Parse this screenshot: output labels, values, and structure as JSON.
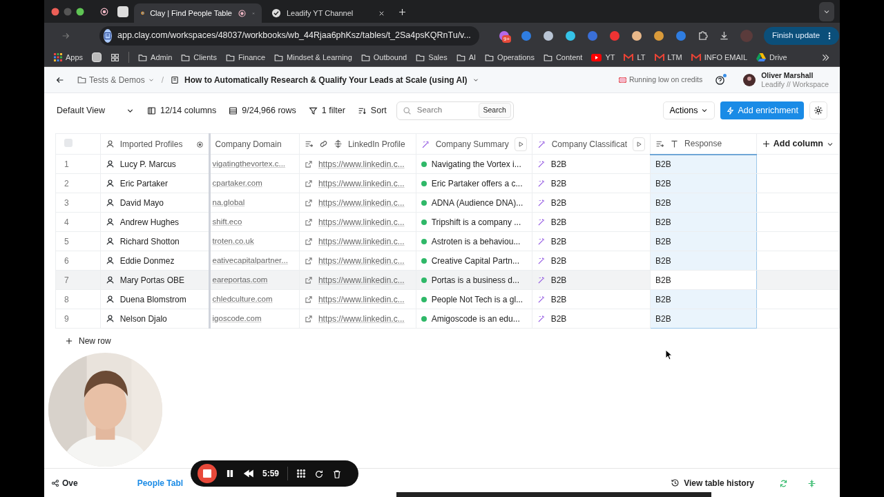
{
  "browser": {
    "tabs": [
      {
        "title": "Clay | Find People Table",
        "selected": true
      },
      {
        "title": "Leadify YT Channel",
        "selected": false
      }
    ],
    "url": "app.clay.com/workspaces/48037/workbooks/wb_44Rjaa6phKsz/tables/t_2Sa4psKQRnTu/v...",
    "extension_badge": "9+",
    "update_button": "Finish update",
    "bookmarks": [
      {
        "label": "Apps",
        "kind": "apps"
      },
      {
        "label": "Admin",
        "kind": "folder"
      },
      {
        "label": "Clients",
        "kind": "folder"
      },
      {
        "label": "Finance",
        "kind": "folder"
      },
      {
        "label": "Mindset & Learning",
        "kind": "folder"
      },
      {
        "label": "Outbound",
        "kind": "folder"
      },
      {
        "label": "Sales",
        "kind": "folder"
      },
      {
        "label": "AI",
        "kind": "folder"
      },
      {
        "label": "Operations",
        "kind": "folder"
      },
      {
        "label": "Content",
        "kind": "folder"
      },
      {
        "label": "YT",
        "kind": "video"
      },
      {
        "label": "LT",
        "kind": "mail"
      },
      {
        "label": "LTM",
        "kind": "mail"
      },
      {
        "label": "INFO EMAIL",
        "kind": "mail"
      },
      {
        "label": "Drive",
        "kind": "drive"
      }
    ]
  },
  "header": {
    "folder": "Tests & Demos",
    "separator": "/",
    "table_title": "How to Automatically Research & Qualify Your Leads at Scale (using AI)",
    "credits": "Running low on credits",
    "user": "Oliver Marshall",
    "workspace": "Leadify // Workspace"
  },
  "toolbar": {
    "view": "Default View",
    "columns": "12/14 columns",
    "rows": "9/24,966 rows",
    "filter": "1 filter",
    "sort": "Sort",
    "search": {
      "placeholder": "Search"
    },
    "search_button": "Search",
    "actions": "Actions",
    "add_enrichment": "Add enrichment"
  },
  "table": {
    "select_all": {
      "checked": false
    },
    "columns": [
      {
        "label": "Imported Profiles",
        "selected": false
      },
      {
        "label": "Company Domain",
        "selected": false
      },
      {
        "label": "LinkedIn Profile",
        "selected": false
      },
      {
        "label": "Company Summary",
        "selected": false
      },
      {
        "label": "Company Classificat",
        "selected": false
      },
      {
        "label": "Response",
        "selected": true
      }
    ],
    "add_column": "Add column",
    "rows": [
      {
        "number": "1",
        "name": "Lucy P. Marcus",
        "domain": "vigatingthevortex.c...",
        "linkedin": "https://www.linkedin.c...",
        "summary": "Navigating the Vortex i...",
        "classification": "B2B",
        "response": "B2B",
        "hovered": false
      },
      {
        "number": "2",
        "name": "Eric Partaker",
        "domain": "cpartaker.com",
        "linkedin": "https://www.linkedin.c...",
        "summary": "Eric Partaker offers a c...",
        "classification": "B2B",
        "response": "B2B",
        "hovered": false
      },
      {
        "number": "3",
        "name": "David Mayo",
        "domain": "na.global",
        "linkedin": "https://www.linkedin.c...",
        "summary": "ADNA (Audience DNA)...",
        "classification": "B2B",
        "response": "B2B",
        "hovered": false
      },
      {
        "number": "4",
        "name": "Andrew Hughes",
        "domain": "shift.eco",
        "linkedin": "https://www.linkedin.c...",
        "summary": "Tripshift is a company ...",
        "classification": "B2B",
        "response": "B2B",
        "hovered": false
      },
      {
        "number": "5",
        "name": "Richard Shotton",
        "domain": "troten.co.uk",
        "linkedin": "https://www.linkedin.c...",
        "summary": "Astroten is a behaviou...",
        "classification": "B2B",
        "response": "B2B",
        "hovered": false
      },
      {
        "number": "6",
        "name": "Eddie Donmez",
        "domain": "eativecapitalpartner...",
        "linkedin": "https://www.linkedin.c...",
        "summary": "Creative Capital Partn...",
        "classification": "B2B",
        "response": "B2B",
        "hovered": false
      },
      {
        "number": "7",
        "name": "Mary Portas OBE",
        "domain": "eareportas.com",
        "linkedin": "https://www.linkedin.c...",
        "summary": "Portas is a business d...",
        "classification": "B2B",
        "response": "B2B",
        "hovered": true
      },
      {
        "number": "8",
        "name": "Duena Blomstrom",
        "domain": "chledculture.com",
        "linkedin": "https://www.linkedin.c...",
        "summary": "People Not Tech is a gl...",
        "classification": "B2B",
        "response": "B2B",
        "hovered": false
      },
      {
        "number": "9",
        "name": "Nelson Djalo",
        "domain": "igoscode.com",
        "linkedin": "https://www.linkedin.c...",
        "summary": "Amigoscode is an edu...",
        "classification": "B2B",
        "response": "B2B",
        "hovered": false
      }
    ],
    "new_row": "New row"
  },
  "bottom_tabs": [
    {
      "label": "Ove",
      "selected": false
    },
    {
      "label": "People Tabl",
      "selected": true
    }
  ],
  "history": "View table history",
  "recorder": {
    "time": "5:59"
  }
}
